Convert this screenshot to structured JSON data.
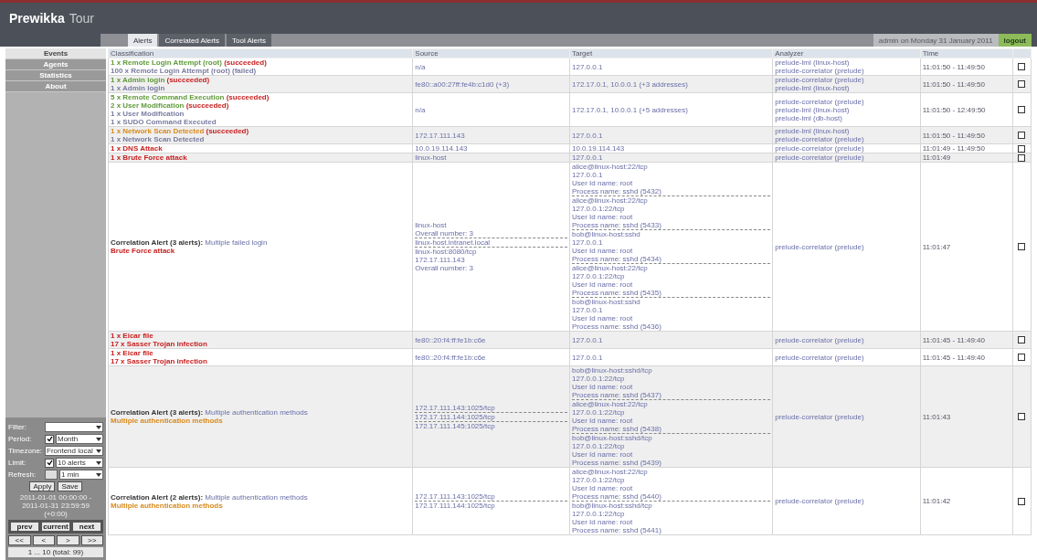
{
  "window": {
    "title": "Prewikka",
    "subtitle": "Tour"
  },
  "tabs": [
    {
      "label": "Alerts",
      "selected": true
    },
    {
      "label": "Correlated Alerts",
      "selected": false
    },
    {
      "label": "Tool Alerts",
      "selected": false
    }
  ],
  "user_info": "admin on Monday 31 January 2011",
  "logout": "logout",
  "sidebar": {
    "items": [
      {
        "label": "Events",
        "selected": true
      },
      {
        "label": "Agents",
        "selected": false
      },
      {
        "label": "Statistics",
        "selected": false
      },
      {
        "label": "About",
        "selected": false
      }
    ]
  },
  "filter_form": {
    "fields": [
      {
        "label": "Filter:",
        "kind": "select"
      },
      {
        "label": "Period:",
        "kind": "check-select",
        "checked": true,
        "value": "Month"
      },
      {
        "label": "Timezone:",
        "kind": "select",
        "value": "Frontend local"
      },
      {
        "label": "Limit:",
        "kind": "check-select",
        "checked": true,
        "value": "10 alerts"
      },
      {
        "label": "Refresh:",
        "kind": "input-select",
        "value": "1 min"
      }
    ],
    "buttons": [
      "Apply",
      "Save"
    ],
    "range": [
      "2011-01-01 00:00:00 -",
      "2011-01-31 23:59:59",
      "(+0:00)"
    ],
    "nav_buttons": [
      "prev",
      "current",
      "next"
    ],
    "page_buttons": [
      "<<",
      "<",
      ">",
      ">>"
    ],
    "page_info": "1 ... 10 (total: 99)"
  },
  "table": {
    "columns": [
      "Classification",
      "Source",
      "Target",
      "Analyzer",
      "Time"
    ],
    "rows": [
      {
        "classification": [
          {
            "kind": "alert",
            "color": "#5f9a3a",
            "text": "1 x Remote Login Attempt (root) **(succeeded)**"
          },
          {
            "kind": "alert",
            "color": "#7a7ca0",
            "text": "100 x Remote Login Attempt (root) (failed)"
          }
        ],
        "source": [
          [
            "n/a"
          ]
        ],
        "target": [
          [
            "127.0.0.1"
          ]
        ],
        "analyzer": [
          "prelude-lml (linux-host)",
          "prelude-correlator (prelude)"
        ],
        "time": "11:01:50 - 11:49:50",
        "checked": false
      },
      {
        "classification": [
          {
            "kind": "alert",
            "color": "#5f9a3a",
            "text": "1 x Admin login **(succeeded)**"
          },
          {
            "kind": "alert",
            "color": "#7a7ca0",
            "text": "1 x Admin login"
          }
        ],
        "source": [
          [
            "fe80::a00:27ff:fe4b:c1d0 (+3)"
          ]
        ],
        "target": [
          [
            "172.17.0.1, 10.0.0.1 (+3 addresses)"
          ]
        ],
        "analyzer": [
          "prelude-correlator (prelude)",
          "prelude-lml (linux-host)"
        ],
        "time": "11:01:50 - 11:49:50",
        "checked": false
      },
      {
        "classification": [
          {
            "kind": "alert",
            "color": "#5f9a3a",
            "text": "5 x Remote Command Execution **(succeeded)**"
          },
          {
            "kind": "alert",
            "color": "#5f9a3a",
            "text": "2 x User Modification **(succeeded)**"
          },
          {
            "kind": "alert",
            "color": "#7a7ca0",
            "text": "1 x User Modification"
          },
          {
            "kind": "alert",
            "color": "#7a7ca0",
            "text": "1 x SUDO Command Executed"
          }
        ],
        "source": [
          [
            "n/a"
          ]
        ],
        "target": [
          [
            "172.17.0.1, 10.0.0.1 (+5 addresses)"
          ]
        ],
        "analyzer": [
          "prelude-correlator (prelude)",
          "prelude-lml (linux-host)",
          "prelude-lml (db-host)"
        ],
        "time": "11:01:50 - 12:49:50",
        "checked": false
      },
      {
        "classification": [
          {
            "kind": "alert",
            "color": "#d88a1c",
            "text": "1 x Network Scan Detected **(succeeded)**"
          },
          {
            "kind": "alert",
            "color": "#7a7ca0",
            "text": "1 x Network Scan Detected"
          }
        ],
        "source": [
          [
            "172.17.111.143"
          ]
        ],
        "target": [
          [
            "127.0.0.1"
          ]
        ],
        "analyzer": [
          "prelude-lml (linux-host)",
          "prelude-correlator (prelude)"
        ],
        "time": "11:01:50 - 11:49:50",
        "checked": false
      },
      {
        "classification": [
          {
            "kind": "alert",
            "color": "#c81e1e",
            "text": "1 x DNS Attack"
          }
        ],
        "source": [
          [
            "10.0.19.114.143"
          ]
        ],
        "target": [
          [
            "10.0.19.114.143"
          ]
        ],
        "analyzer": [
          "prelude-correlator (prelude)"
        ],
        "time": "11:01:49 - 11:49:50",
        "checked": false
      },
      {
        "classification": [
          {
            "kind": "alert",
            "color": "#c81e1e",
            "text": "1 x Brute Force attack"
          }
        ],
        "source": [
          [
            "linux-host"
          ]
        ],
        "target": [
          [
            "127.0.0.1"
          ]
        ],
        "analyzer": [
          "prelude-correlator (prelude)"
        ],
        "time": "11:01:49",
        "checked": false
      },
      {
        "classification": [
          {
            "kind": "correlation",
            "title": "Correlation Alert (3 alerts):",
            "link": "Multiple failed login"
          },
          {
            "kind": "alert",
            "color": "#c81e1e",
            "text": "Brute Force attack"
          }
        ],
        "source": [
          [
            "linux-host",
            "Overall number: 3"
          ],
          [
            "linux-host.intranet.local"
          ],
          [
            "linux-host:8080/tcp",
            "172.17.111.143",
            "Overall number: 3"
          ]
        ],
        "target": [
          [
            "alice@linux-host:22/tcp",
            "127.0.0.1",
            "User Id name: root",
            "Process name: sshd (5432)"
          ],
          [
            "alice@linux-host:22/tcp",
            "127.0.0.1:22/tcp",
            "User Id name: root",
            "Process name: sshd (5433)"
          ],
          [
            "bob@linux-host:sshd",
            "127.0.0.1",
            "User Id name: root",
            "Process name: sshd (5434)"
          ],
          [
            "alice@linux-host:22/tcp",
            "127.0.0.1:22/tcp",
            "User Id name: root",
            "Process name: sshd (5435)"
          ],
          [
            "bob@linux-host:sshd",
            "127.0.0.1",
            "User Id name: root",
            "Process name: sshd (5436)"
          ]
        ],
        "analyzer": [
          "prelude-correlator (prelude)"
        ],
        "time": "11:01:47",
        "checked": false
      },
      {
        "classification": [
          {
            "kind": "alert",
            "color": "#c81e1e",
            "text": "1 x Eicar file"
          },
          {
            "kind": "alert",
            "color": "#c81e1e",
            "text": "17 x Sasser Trojan infection"
          }
        ],
        "source": [
          [
            "fe80::20:f4:ff:fe1b:c6e"
          ]
        ],
        "target": [
          [
            "127.0.0.1"
          ]
        ],
        "analyzer": [
          "prelude-correlator (prelude)"
        ],
        "time": "11:01:45 - 11:49:40",
        "checked": false
      },
      {
        "classification": [
          {
            "kind": "alert",
            "color": "#c81e1e",
            "text": "1 x Eicar file"
          },
          {
            "kind": "alert",
            "color": "#c81e1e",
            "text": "17 x Sasser Trojan infection"
          }
        ],
        "source": [
          [
            "fe80::20:f4:ff:fe1b:c6e"
          ]
        ],
        "target": [
          [
            "127.0.0.1"
          ]
        ],
        "analyzer": [
          "prelude-correlator (prelude)"
        ],
        "time": "11:01:45 - 11:49:40",
        "checked": false
      },
      {
        "classification": [
          {
            "kind": "correlation",
            "title": "Correlation Alert (3 alerts):",
            "link": "Multiple authentication methods"
          },
          {
            "kind": "alert",
            "color": "#d88a1c",
            "text": "Multiple authentication methods"
          }
        ],
        "source": [
          [
            "172.17.111.143:1025/tcp"
          ],
          [
            "172.17.111.144:1025/tcp"
          ],
          [
            "172.17.111.145:1025/tcp"
          ]
        ],
        "target": [
          [
            "bob@linux-host:sshd/tcp",
            "127.0.0.1:22/tcp",
            "User Id name: root",
            "Process name: sshd (5437)"
          ],
          [
            "alice@linux-host:22/tcp",
            "127.0.0.1:22/tcp",
            "User Id name: root",
            "Process name: sshd (5438)"
          ],
          [
            "bob@linux-host:sshd/tcp",
            "127.0.0.1:22/tcp",
            "User Id name: root",
            "Process name: sshd (5439)"
          ]
        ],
        "analyzer": [
          "prelude-correlator (prelude)"
        ],
        "time": "11:01:43",
        "checked": false
      },
      {
        "classification": [
          {
            "kind": "correlation",
            "title": "Correlation Alert (2 alerts):",
            "link": "Multiple authentication methods"
          },
          {
            "kind": "alert",
            "color": "#d88a1c",
            "text": "Multiple authentication methods"
          }
        ],
        "source": [
          [
            "172.17.111.143:1025/tcp"
          ],
          [
            "172.17.111.144:1025/tcp"
          ]
        ],
        "target": [
          [
            "alice@linux-host:22/tcp",
            "127.0.0.1:22/tcp",
            "User Id name: root",
            "Process name: sshd (5440)"
          ],
          [
            "bob@linux-host:sshd/tcp",
            "127.0.0.1:22/tcp",
            "User Id name: root",
            "Process name: sshd (5441)"
          ]
        ],
        "analyzer": [
          "prelude-correlator (prelude)"
        ],
        "time": "11:01:42",
        "checked": false
      }
    ]
  }
}
